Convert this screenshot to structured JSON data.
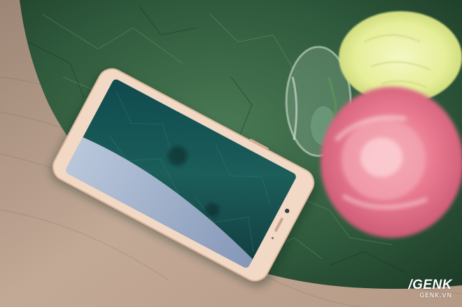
{
  "watermark": {
    "logo": "/GENK",
    "site": "GENK.VN"
  },
  "colors": {
    "floor": "#b59a85",
    "marble": "#2f5a3c",
    "phone_body": "#f1d9c6",
    "flower_pink": "#e8798f",
    "flower_yellow": "#e6ef9a"
  }
}
